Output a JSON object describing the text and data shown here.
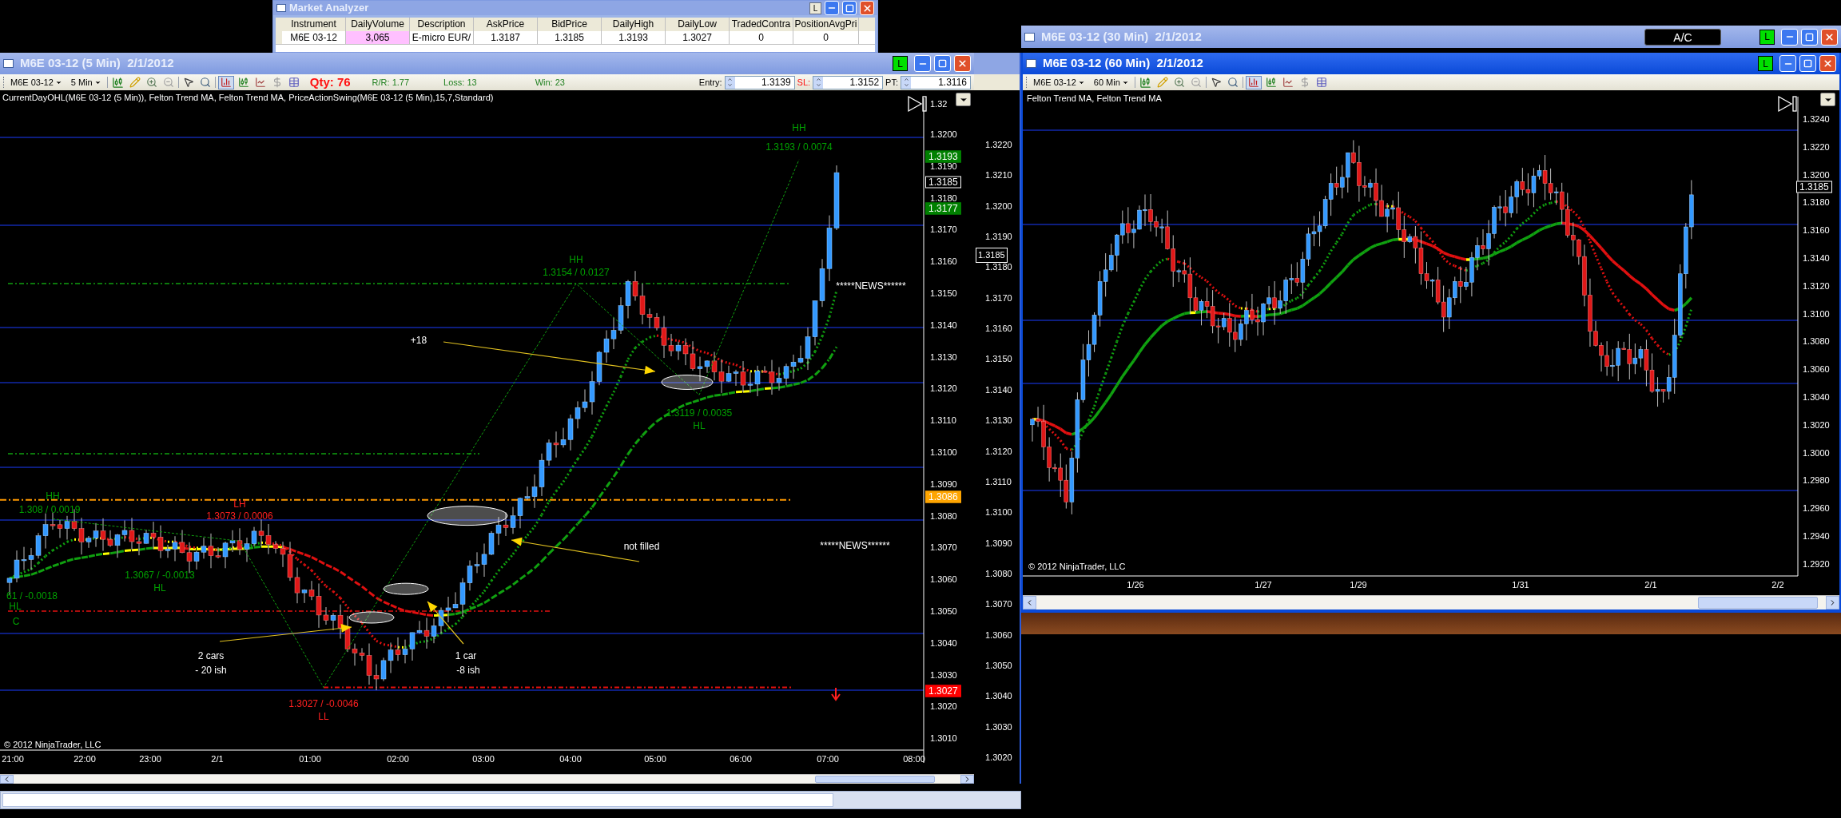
{
  "market_analyzer": {
    "title": "Market Analyzer",
    "active": false,
    "status": "L",
    "columns": [
      "Instrument",
      "DailyVolume",
      "Description",
      "AskPrice",
      "BidPrice",
      "DailyHigh",
      "DailyLow",
      "TradedContra",
      "PositionAvgPri"
    ],
    "rows": [
      {
        "cells": [
          {
            "text": "M6E 03-12"
          },
          {
            "text": "3,065",
            "color": "#ffc0ff"
          },
          {
            "text": "E-micro EUR/"
          },
          {
            "text": "1.3187"
          },
          {
            "text": "1.3185"
          },
          {
            "text": "1.3193"
          },
          {
            "text": "1.3027"
          },
          {
            "text": "0"
          },
          {
            "text": "0"
          }
        ]
      }
    ]
  },
  "chart_5min": {
    "title": "M6E 03-12 (5 Min)  2/1/2012",
    "active": false,
    "status": "L",
    "toolbar": {
      "instrument": "M6E 03-12",
      "interval": "5 Min",
      "qty": "Qty: 76",
      "rr": "R/R: 1.77",
      "loss": "Loss: 13",
      "win": "Win: 23",
      "entry_label": "Entry:",
      "entry": "1.3139",
      "sl_label": "SL:",
      "sl": "1.3152",
      "pt_label": "PT:",
      "pt": "1.3116"
    },
    "indicators": "CurrentDayOHL(M6E 03-12 (5 Min)), Felton Trend MA, Felton Trend MA, PriceActionSwing(M6E 03-12 (5 Min),15,7,Standard)",
    "price_axis": [
      "1.32",
      "1.3200",
      "1.3190",
      "1.3180",
      "1.3170",
      "1.3160",
      "1.3150",
      "1.3140",
      "1.3130",
      "1.3120",
      "1.3110",
      "1.3100",
      "1.3090",
      "1.3080",
      "1.3070",
      "1.3060",
      "1.3050",
      "1.3040",
      "1.3030",
      "1.3020",
      "1.3010"
    ],
    "price_tags": [
      {
        "text": "1.3193",
        "color": "#008000"
      },
      {
        "text": "1.3185",
        "color": "#000000"
      },
      {
        "text": "1.3177",
        "color": "#008000"
      },
      {
        "text": "1.3086",
        "color": "#ffa500"
      },
      {
        "text": "1.3027",
        "color": "#ff0000"
      }
    ],
    "time_axis": [
      "21:00",
      "22:00",
      "23:00",
      "2/1",
      "01:00",
      "02:00",
      "03:00",
      "04:00",
      "05:00",
      "06:00",
      "07:00",
      "08:00"
    ],
    "annotations": [
      {
        "text": "HH",
        "color": "#00a000"
      },
      {
        "text": "1.3193 / 0.0074",
        "color": "#00a000"
      },
      {
        "text": "HH",
        "color": "#00a000"
      },
      {
        "text": "1.3154 / 0.0127",
        "color": "#00a000"
      },
      {
        "text": "*****NEWS******",
        "color": "#ffffff"
      },
      {
        "text": "+18",
        "color": "#ffffff"
      },
      {
        "text": "1.3119 / 0.0035",
        "color": "#00a000"
      },
      {
        "text": "HL",
        "color": "#00a000"
      },
      {
        "text": "HH",
        "color": "#00a000"
      },
      {
        "text": "1.308 / 0.0019",
        "color": "#00a000"
      },
      {
        "text": "LH",
        "color": "#ff2020"
      },
      {
        "text": "1.3073 / 0.0006",
        "color": "#ff2020"
      },
      {
        "text": "not filled",
        "color": "#ffffff"
      },
      {
        "text": "*****NEWS******",
        "color": "#ffffff"
      },
      {
        "text": "1.3067 / -0.0013",
        "color": "#00a000"
      },
      {
        "text": "HL",
        "color": "#00a000"
      },
      {
        "text": "61 / -0.0018",
        "color": "#00a000"
      },
      {
        "text": "HL",
        "color": "#00a000"
      },
      {
        "text": "C",
        "color": "#00a000"
      },
      {
        "text": "2 cars",
        "color": "#ffffff"
      },
      {
        "text": "- 20 ish",
        "color": "#ffffff"
      },
      {
        "text": "1 car",
        "color": "#ffffff"
      },
      {
        "text": "-8 ish",
        "color": "#ffffff"
      },
      {
        "text": "1.3027 / -0.0046",
        "color": "#ff2020"
      },
      {
        "text": "LL",
        "color": "#ff2020"
      }
    ],
    "copyright": "© 2012 NinjaTrader, LLC"
  },
  "background_chart": {
    "price_axis": [
      "1.3220",
      "1.3210",
      "1.3200",
      "1.3190",
      "1.3180",
      "1.3170",
      "1.3160",
      "1.3150",
      "1.3140",
      "1.3130",
      "1.3120",
      "1.3110",
      "1.3100",
      "1.3090",
      "1.3080",
      "1.3070",
      "1.3060",
      "1.3050",
      "1.3040",
      "1.3030",
      "1.3020"
    ],
    "price_tag": "1.3185"
  },
  "chart_30min": {
    "title": "M6E 03-12 (30 Min)  2/1/2012",
    "active": false,
    "status": "L",
    "account_button": "A/C"
  },
  "chart_60min": {
    "title": "M6E 03-12 (60 Min)  2/1/2012",
    "active": true,
    "status": "L",
    "toolbar": {
      "instrument": "M6E 03-12",
      "interval": "60 Min"
    },
    "indicators": "Felton Trend MA, Felton Trend MA",
    "price_axis": [
      "1.3240",
      "1.3220",
      "1.3200",
      "1.3180",
      "1.3160",
      "1.3140",
      "1.3120",
      "1.3100",
      "1.3080",
      "1.3060",
      "1.3040",
      "1.3020",
      "1.3000",
      "1.2980",
      "1.2960",
      "1.2940",
      "1.2920"
    ],
    "price_tags": [
      {
        "text": "1.3185",
        "color": "#000000"
      }
    ],
    "time_axis": [
      "1/26",
      "1/27",
      "1/29",
      "1/31",
      "2/1",
      "2/2"
    ],
    "copyright": "© 2012 NinjaTrader, LLC"
  }
}
